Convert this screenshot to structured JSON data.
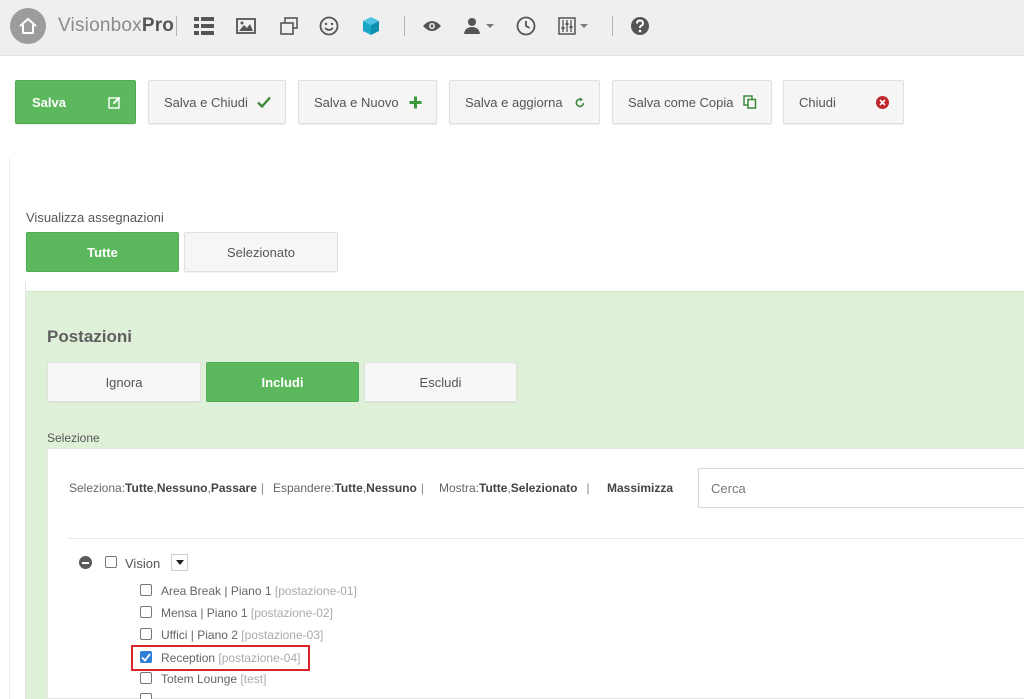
{
  "navbar": {
    "brand_light": "Visionbox",
    "brand_bold": "Pro",
    "icons": [
      "home-icon",
      "list-icon",
      "image-icon",
      "layers-icon",
      "smiley-icon",
      "cube-icon",
      "eye-icon",
      "user-icon",
      "clock-icon",
      "sliders-icon",
      "help-icon"
    ]
  },
  "toolbar": {
    "save": "Salva",
    "save_close": "Salva e Chiudi",
    "save_new": "Salva e Nuovo",
    "save_update": "Salva e aggiorna",
    "save_copy": "Salva come Copia",
    "close": "Chiudi"
  },
  "assignments": {
    "label": "Visualizza assegnazioni",
    "all": "Tutte",
    "selected": "Selezionato"
  },
  "stations": {
    "title": "Postazioni",
    "ignore": "Ignora",
    "include": "Includi",
    "exclude": "Escludi",
    "selection_label": "Selezione"
  },
  "selection_toolbar": {
    "select_label": "Seleziona:",
    "select_all": "Tutte",
    "select_none": "Nessuno",
    "select_pass": "Passare",
    "expand_label": "Espandere:",
    "expand_all": "Tutte",
    "expand_none": "Nessuno",
    "show_label": "Mostra:",
    "show_all": "Tutte",
    "show_selected": "Selezionato",
    "maximize": "Massimizza",
    "search_placeholder": "Cerca"
  },
  "tree": {
    "root": "Vision",
    "items": [
      {
        "name": "Area Break | Piano 1",
        "code": "[postazione-01]",
        "checked": false
      },
      {
        "name": "Mensa | Piano 1",
        "code": "[postazione-02]",
        "checked": false
      },
      {
        "name": "Uffici | Piano 2",
        "code": "[postazione-03]",
        "checked": false
      },
      {
        "name": "Reception",
        "code": "[postazione-04]",
        "checked": true
      },
      {
        "name": "Totem Lounge",
        "code": "[test]",
        "checked": false
      }
    ]
  },
  "colors": {
    "primary_green": "#5cb85c",
    "panel_green": "#dff0d8",
    "highlight_red": "#d9242b",
    "check_blue": "#2f7fd6",
    "accent_cyan": "#1aa6c8"
  }
}
